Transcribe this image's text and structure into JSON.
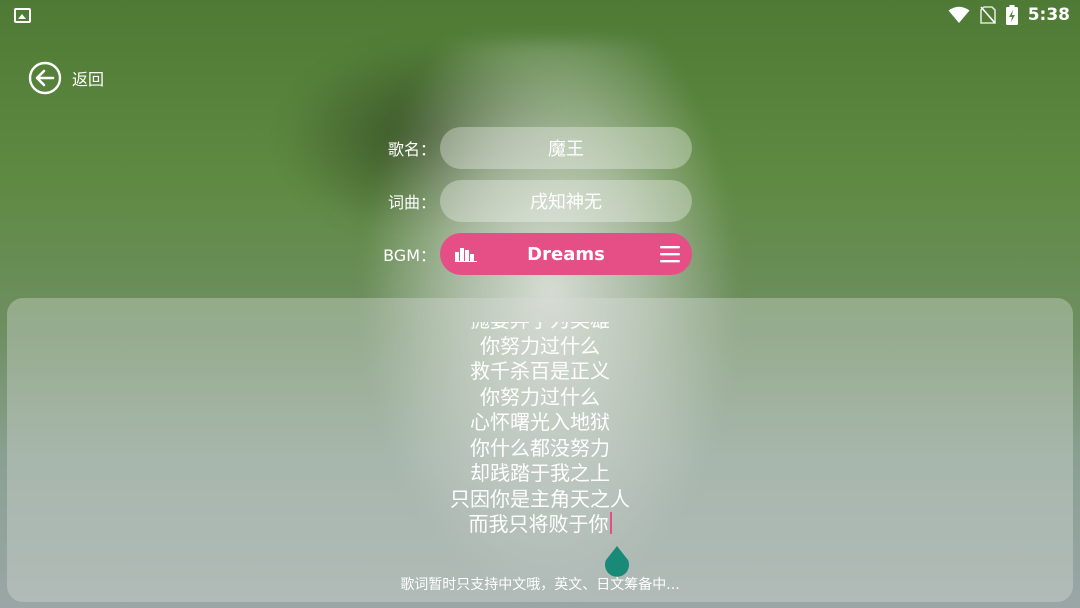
{
  "status": {
    "time": "5:38"
  },
  "nav": {
    "back_label": "返回"
  },
  "form": {
    "title_label": "歌名：",
    "title_value": "魔王",
    "composer_label": "词曲：",
    "composer_value": "戌知神无",
    "bgm_label": "BGM：",
    "bgm_value": "Dreams"
  },
  "lyrics": {
    "lines": [
      "抛妻弃子为英雄",
      "你努力过什么",
      "救千杀百是正义",
      "你努力过什么",
      "心怀曙光入地狱",
      "你什么都没努力",
      "却践踏于我之上",
      "只因你是主角天之人",
      "而我只将败于你"
    ],
    "hint": "歌词暂时只支持中文哦，英文、日文筹备中..."
  },
  "colors": {
    "accent": "#e64f86",
    "handle": "#1a8a78"
  },
  "icons": {
    "back": "back-arrow-icon",
    "bgm_left": "equalizer-icon",
    "bgm_right": "menu-icon"
  }
}
